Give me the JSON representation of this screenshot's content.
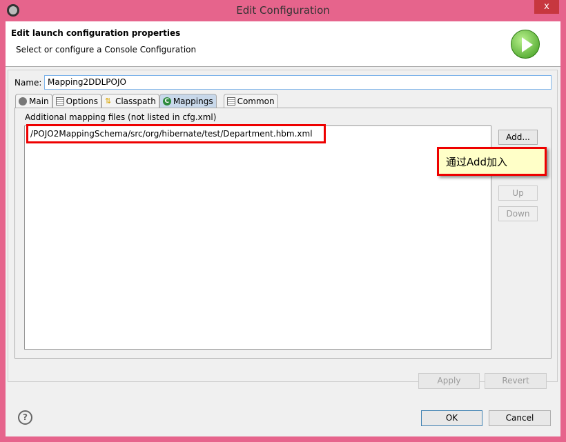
{
  "window": {
    "title": "Edit Configuration",
    "close": "x"
  },
  "header": {
    "title": "Edit launch configuration properties",
    "subtitle": "Select or configure a Console Configuration"
  },
  "name": {
    "label": "Name:",
    "value": "Mapping2DDLPOJO"
  },
  "tabs": [
    {
      "label": "Main",
      "icon": "gear-icon"
    },
    {
      "label": "Options",
      "icon": "table-icon"
    },
    {
      "label": "Classpath",
      "icon": "classpath-icon"
    },
    {
      "label": "Mappings",
      "icon": "c-icon",
      "active": true
    },
    {
      "label": "Common",
      "icon": "table-icon"
    }
  ],
  "mappings": {
    "label": "Additional mapping files (not listed in cfg.xml)",
    "files": [
      "/POJO2MappingSchema/src/org/hibernate/test/Department.hbm.xml"
    ],
    "add": "Add...",
    "up": "Up",
    "down": "Down"
  },
  "callout": "通过Add加入",
  "footer": {
    "apply": "Apply",
    "revert": "Revert",
    "ok": "OK",
    "cancel": "Cancel",
    "help": "?"
  }
}
